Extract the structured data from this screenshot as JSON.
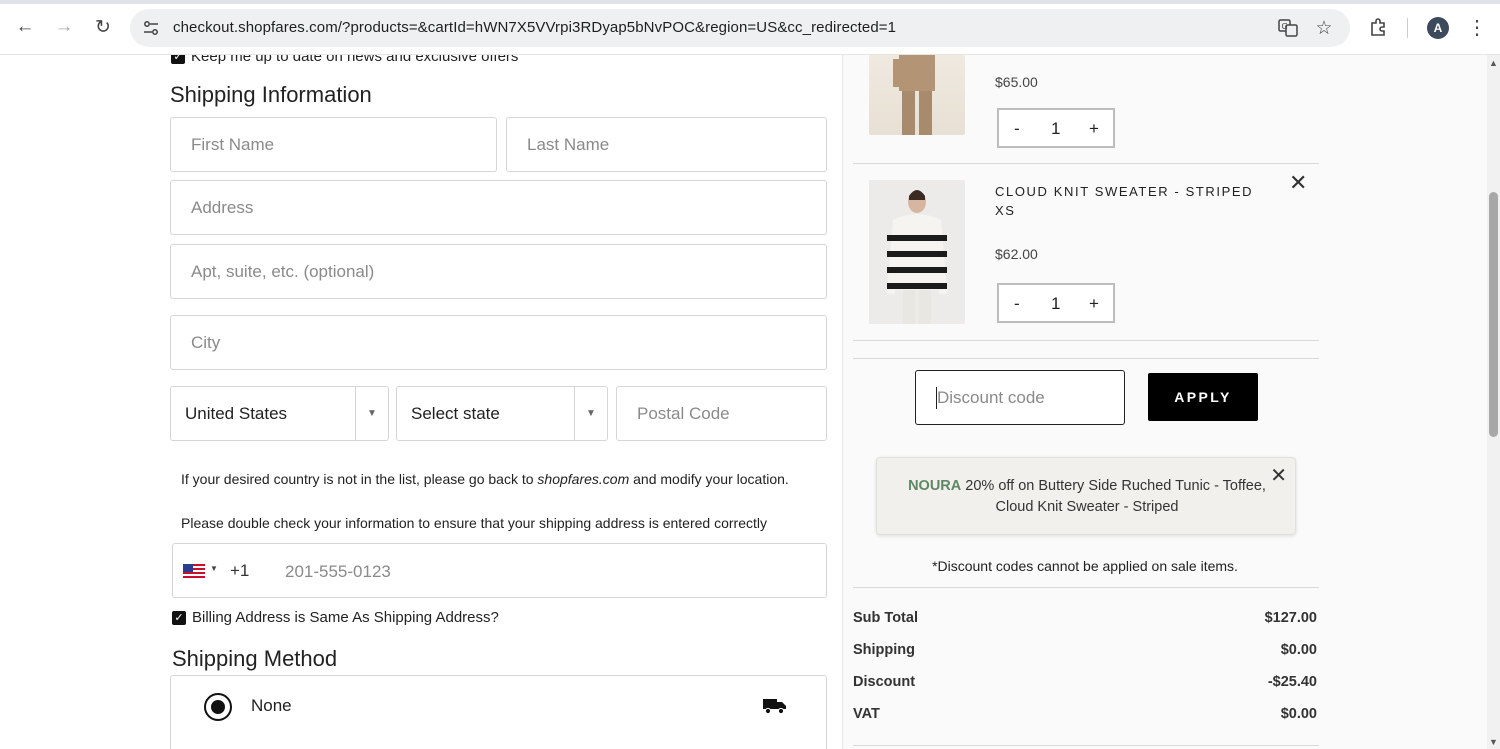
{
  "browser": {
    "url": "checkout.shopfares.com/?products=&cartId=hWN7X5VVrpi3RDyap5bNvPOC&region=US&cc_redirected=1",
    "profile_initial": "A",
    "icons": [
      "back-arrow-icon",
      "forward-arrow-icon",
      "reload-icon",
      "site-settings-icon",
      "translate-icon",
      "bookmark-star-icon",
      "extensions-icon",
      "menu-dots-icon"
    ]
  },
  "form": {
    "newsletter_label": "Keep me up to date on news and exclusive offers",
    "newsletter_checked": true,
    "shipping_title": "Shipping Information",
    "first_name_placeholder": "First Name",
    "last_name_placeholder": "Last Name",
    "address_placeholder": "Address",
    "apt_placeholder": "Apt, suite, etc. (optional)",
    "city_placeholder": "City",
    "country_value": "United States",
    "state_placeholder": "Select state",
    "postal_placeholder": "Postal Code",
    "country_note_before": "If your desired country is not in the list, please go back to ",
    "country_note_link": "shopfares.com",
    "country_note_after": " and modify your location.",
    "double_check_note": "Please double check your information to ensure that your shipping address is entered correctly",
    "phone_code": "+1",
    "phone_placeholder": "201-555-0123",
    "billing_same_label": "Billing Address is Same As Shipping Address?",
    "billing_same_checked": true,
    "shipping_method_title": "Shipping Method",
    "shipping_option_label": "None"
  },
  "cart": {
    "items": [
      {
        "title": "",
        "price": "$65.00",
        "qty": "1"
      },
      {
        "title_line1": "CLOUD KNIT SWEATER - STRIPED",
        "title_line2": "XS",
        "price": "$62.00",
        "qty": "1"
      }
    ],
    "qty_minus": "-",
    "qty_plus": "+",
    "discount_placeholder": "Discount code",
    "apply_label": "APPLY",
    "promo_code": "NOURA",
    "promo_text_line1": " 20% off on Buttery Side Ruched Tunic - Toffee,",
    "promo_text_line2": "Cloud Knit Sweater - Striped",
    "discount_note": "*Discount codes cannot be applied on sale items.",
    "summary": [
      {
        "label": "Sub Total",
        "value": "$127.00"
      },
      {
        "label": "Shipping",
        "value": "$0.00"
      },
      {
        "label": "Discount",
        "value": "-$25.40"
      },
      {
        "label": "VAT",
        "value": "$0.00"
      }
    ]
  }
}
